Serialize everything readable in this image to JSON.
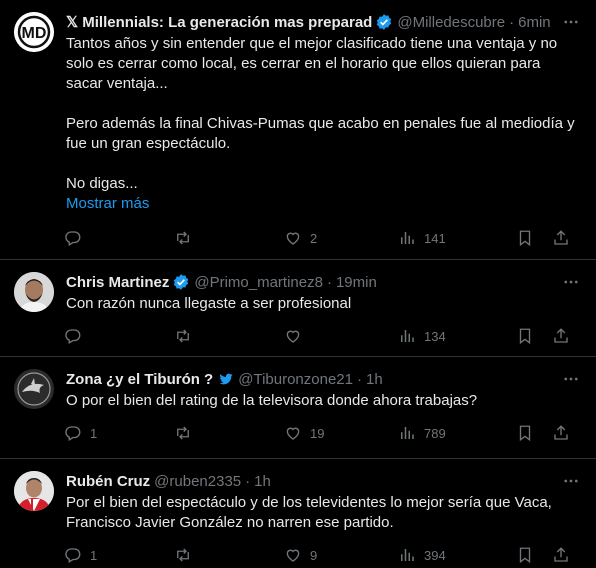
{
  "posts": [
    {
      "name": "𝕏 Millennials: La generación mas preparad",
      "handle": "@Milledescubre",
      "time": "6min",
      "text": "Tantos años y sin entender que el mejor clasificado tiene una ventaja y no solo es cerrar como local, es cerrar en el horario que ellos quieran para sacar ventaja...\n\nPero además la final Chivas-Pumas que acabo en penales fue al mediodía y fue un gran espectáculo.\n\nNo digas...",
      "show_more": "Mostrar más",
      "replies": "",
      "reposts": "",
      "likes": "2",
      "views": "141"
    },
    {
      "name": "Chris Martinez",
      "handle": "@Primo_martinez8",
      "time": "19min",
      "text": "Con razón nunca llegaste a ser profesional",
      "views": "134"
    },
    {
      "name": "Zona ¿y el Tiburón ?",
      "handle": "@Tiburonzone21",
      "time": "1h",
      "text": "O por el bien del rating de la televisora donde ahora trabajas?",
      "replies": "1",
      "reposts": "",
      "likes": "19",
      "views": "789"
    },
    {
      "name": "Rubén Cruz",
      "handle": "@ruben2335",
      "time": "1h",
      "text": "Por el bien del espectáculo y de los televidentes lo mejor sería que Vaca, Francisco Javier González no narren ese partido.",
      "replies": "1",
      "reposts": "",
      "likes": "9",
      "views": "394"
    }
  ],
  "separator": "·",
  "colors": {
    "background": "#000000",
    "text": "#e7e9ea",
    "muted": "#71767b",
    "link": "#1d9bf0",
    "verified": "#1d9bf0",
    "border": "#2f3336"
  }
}
